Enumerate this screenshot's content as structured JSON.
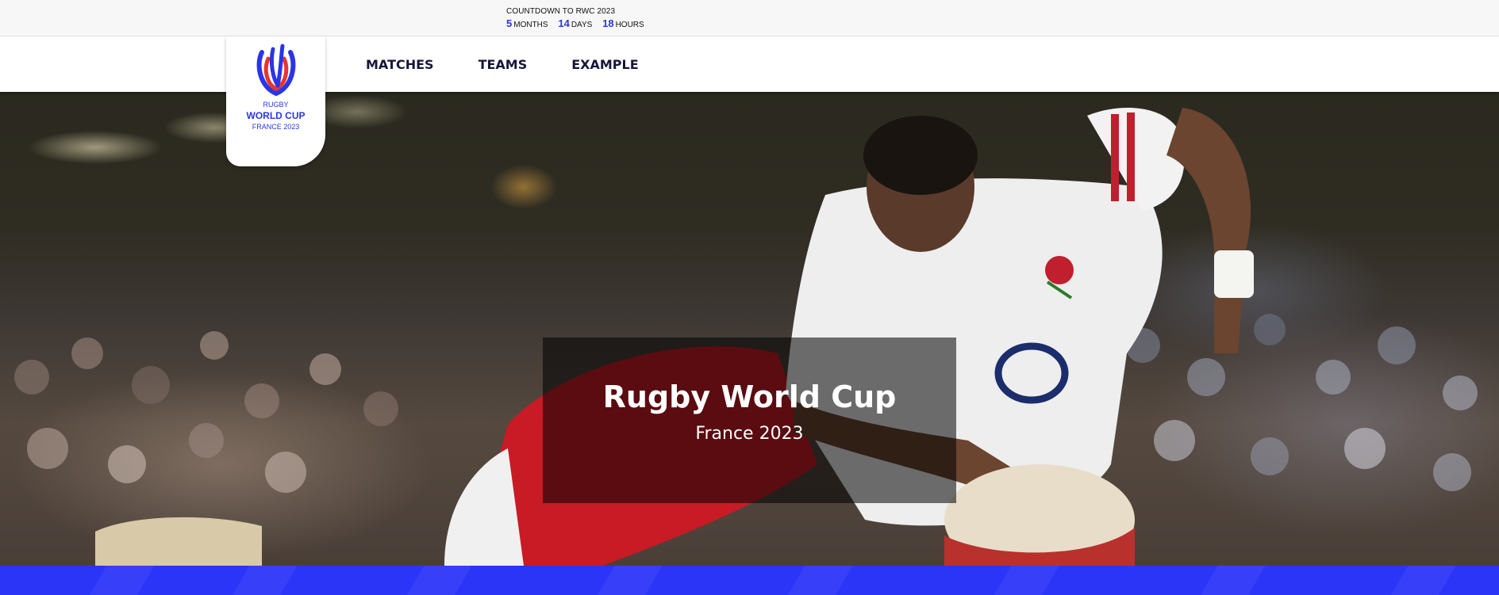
{
  "countdown": {
    "title": "COUNTDOWN TO RWC 2023",
    "months_value": "5",
    "months_unit": "MONTHS",
    "days_value": "14",
    "days_unit": "DAYS",
    "hours_value": "18",
    "hours_unit": "HOURS"
  },
  "logo": {
    "line1": "RUGBY",
    "line2": "WORLD CUP",
    "line3": "FRANCE 2023",
    "icon": "rwc-logo-icon"
  },
  "nav": {
    "items": [
      {
        "label": "MATCHES"
      },
      {
        "label": "TEAMS"
      },
      {
        "label": "EXAMPLE"
      }
    ]
  },
  "hero": {
    "title": "Rugby World Cup",
    "subtitle": "France 2023",
    "image": "rugby-player-scoring-try-photo"
  },
  "colors": {
    "accent": "#2b35f8",
    "countdown_number": "#2a35e6",
    "nav_text": "#16163a",
    "logo_red": "#e8352b"
  }
}
